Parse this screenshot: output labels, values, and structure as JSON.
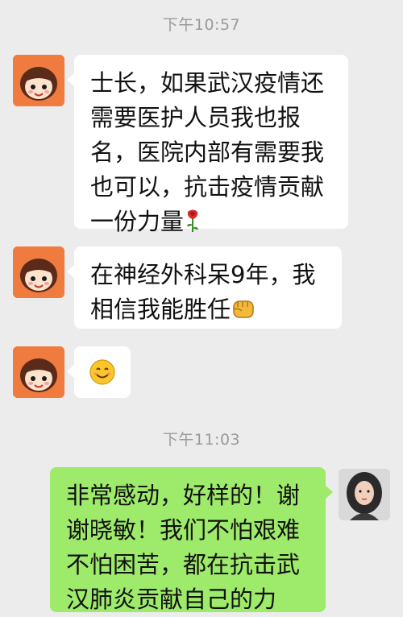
{
  "timestamps": [
    "下午10:57",
    "下午11:03"
  ],
  "messages": [
    {
      "sender": "other",
      "text": "士长，如果武汉疫情还需要医护人员我也报名，医院内部有需要我也可以，抗击疫情贡献一份力量",
      "emoji": "rose-icon"
    },
    {
      "sender": "other",
      "text": "在神经外科呆9年，我相信我能胜任",
      "emoji": "fist-icon"
    },
    {
      "sender": "other",
      "text": "",
      "emoji": "smile-icon"
    },
    {
      "sender": "self",
      "text": "非常感动，好样的！谢谢晓敏！我们不怕艰难不怕困苦，都在抗击武汉肺炎贡献自己的力"
    }
  ],
  "colors": {
    "background": "#ececec",
    "incoming_bubble": "#ffffff",
    "outgoing_bubble": "#9eea6a",
    "avatar_orange": "#f07b3f"
  }
}
